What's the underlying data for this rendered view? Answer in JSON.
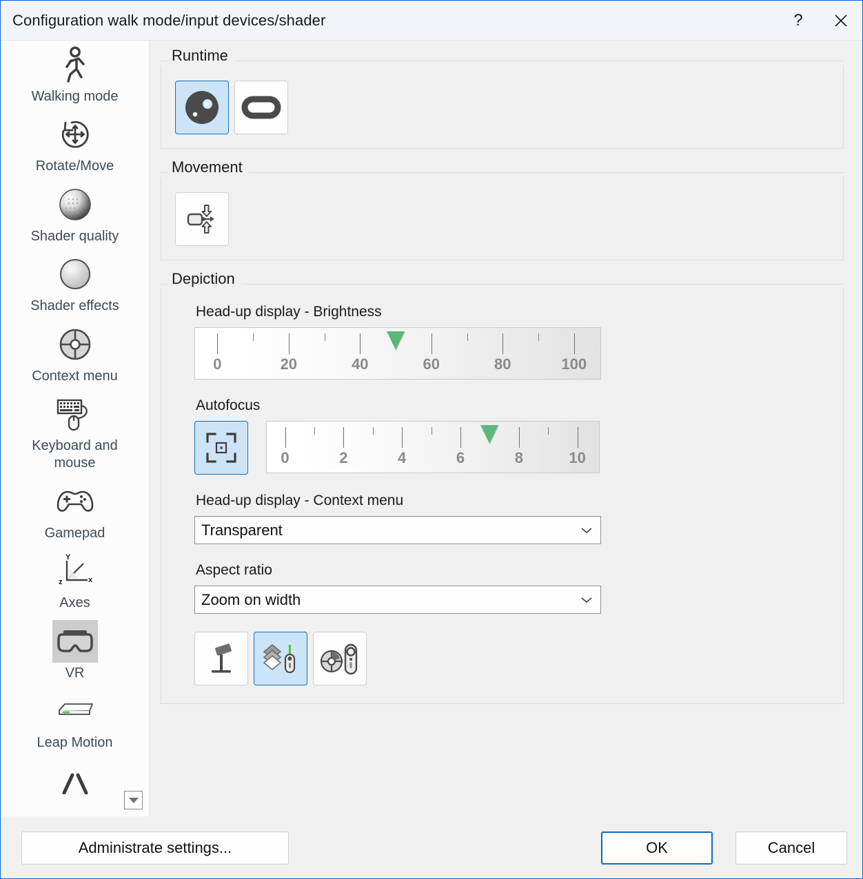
{
  "window": {
    "title": "Configuration walk mode/input devices/shader",
    "help_label": "?",
    "close_label": "✕"
  },
  "sidebar": {
    "scroll_down_label": "",
    "items": [
      {
        "label": "Walking mode",
        "icon": "walking-person-icon",
        "selected": false
      },
      {
        "label": "Rotate/Move",
        "icon": "rotate-move-icon",
        "selected": false
      },
      {
        "label": "Shader quality",
        "icon": "shaded-sphere-icon",
        "selected": false
      },
      {
        "label": "Shader effects",
        "icon": "glossy-sphere-icon",
        "selected": false
      },
      {
        "label": "Context menu",
        "icon": "radial-menu-icon",
        "selected": false
      },
      {
        "label": "Keyboard and mouse",
        "icon": "keyboard-mouse-icon",
        "selected": false
      },
      {
        "label": "Gamepad",
        "icon": "gamepad-icon",
        "selected": false
      },
      {
        "label": "Axes",
        "icon": "axes-xyz-icon",
        "selected": false
      },
      {
        "label": "VR",
        "icon": "vr-headset-icon",
        "selected": true
      },
      {
        "label": "Leap Motion",
        "icon": "leap-motion-icon",
        "selected": false
      }
    ]
  },
  "main": {
    "groups": {
      "runtime": {
        "title": "Runtime",
        "tiles": [
          {
            "name": "steam-runtime-tile",
            "icon": "steam-icon",
            "selected": true
          },
          {
            "name": "oculus-runtime-tile",
            "icon": "oculus-icon",
            "selected": false
          }
        ]
      },
      "movement": {
        "title": "Movement",
        "tiles": [
          {
            "name": "movement-mode-tile",
            "icon": "move-vertical-icon",
            "selected": false
          }
        ]
      },
      "depiction": {
        "title": "Depiction",
        "brightness": {
          "label": "Head-up display - Brightness",
          "value": 50,
          "min": 0,
          "max": 100,
          "major_ticks": [
            0,
            20,
            40,
            60,
            80,
            100
          ],
          "minor_ticks": [
            10,
            30,
            50,
            70,
            90
          ],
          "tick_labels": [
            "0",
            "20",
            "40",
            "60",
            "80",
            "100"
          ]
        },
        "autofocus": {
          "label": "Autofocus",
          "toggle_icon": "focus-frame-icon",
          "toggle_selected": true,
          "value": 7,
          "min": 0,
          "max": 10,
          "major_ticks": [
            0,
            2,
            4,
            6,
            8,
            10
          ],
          "minor_ticks": [
            1,
            3,
            5,
            7,
            9
          ],
          "tick_labels": [
            "0",
            "2",
            "4",
            "6",
            "8",
            "10"
          ]
        },
        "context_menu": {
          "label": "Head-up display - Context menu",
          "value": "Transparent",
          "chevron": "chevron-down-icon"
        },
        "aspect_ratio": {
          "label": "Aspect ratio",
          "value": "Zoom on width",
          "chevron": "chevron-down-icon"
        },
        "depiction_tiles": [
          {
            "name": "base-station-tile",
            "icon": "base-station-icon",
            "selected": false
          },
          {
            "name": "layers-controller-tile",
            "icon": "layers-controller-icon",
            "selected": true
          },
          {
            "name": "radial-controller-tile",
            "icon": "radial-controller-icon",
            "selected": false
          }
        ]
      }
    }
  },
  "footer": {
    "administrate_label": "Administrate settings...",
    "ok_label": "OK",
    "cancel_label": "Cancel"
  },
  "colors": {
    "accent": "#0f6cbd",
    "selection_bg": "#cce4f7",
    "selection_border": "#1a6fb5",
    "marker_green": "#5cb87a",
    "sidebar_selected_bg": "#cdcdcd",
    "label_blue": "#3b4a5a"
  }
}
